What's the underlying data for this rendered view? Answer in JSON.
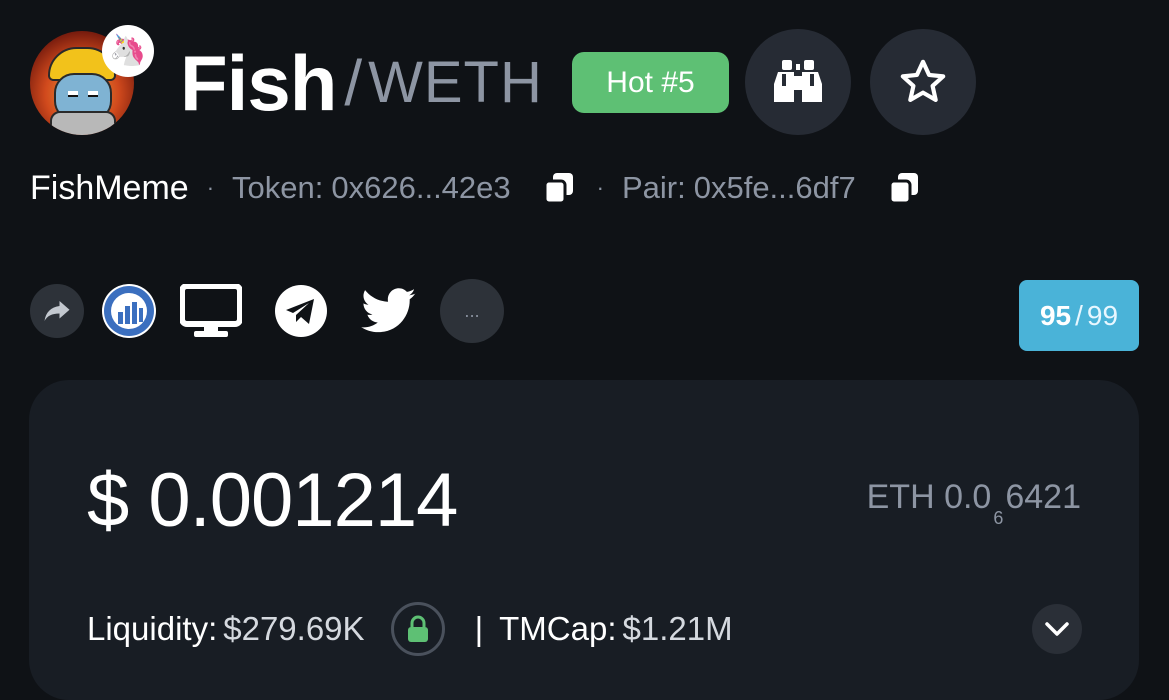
{
  "header": {
    "base_symbol": "Fish",
    "slash": "/",
    "quote_symbol": "WETH",
    "hot_badge": "Hot #5",
    "dex_badge_icon": "uniswap-unicorn-icon"
  },
  "meta": {
    "name": "FishMeme",
    "dot": "·",
    "token_label": "Token:",
    "token_address": "0x626...42e3",
    "pair_label": "Pair:",
    "pair_address": "0x5fe...6df7"
  },
  "links": {
    "more_label": "..."
  },
  "score": {
    "value": "95",
    "separator": "/",
    "max": "99"
  },
  "price": {
    "usd": "$ 0.001214",
    "eth_prefix": "ETH 0.0",
    "eth_zeros": "6",
    "eth_digits": "6421"
  },
  "stats": {
    "liquidity_label": "Liquidity:",
    "liquidity_value": "$279.69K",
    "pipe": "|",
    "tmcap_label": "TMCap:",
    "tmcap_value": "$1.21M"
  },
  "colors": {
    "background": "#0f1216",
    "hot_badge": "#5ec074",
    "score_badge": "#4ab3d8",
    "lock": "#5ec074",
    "muted_text": "#8d95a3"
  }
}
